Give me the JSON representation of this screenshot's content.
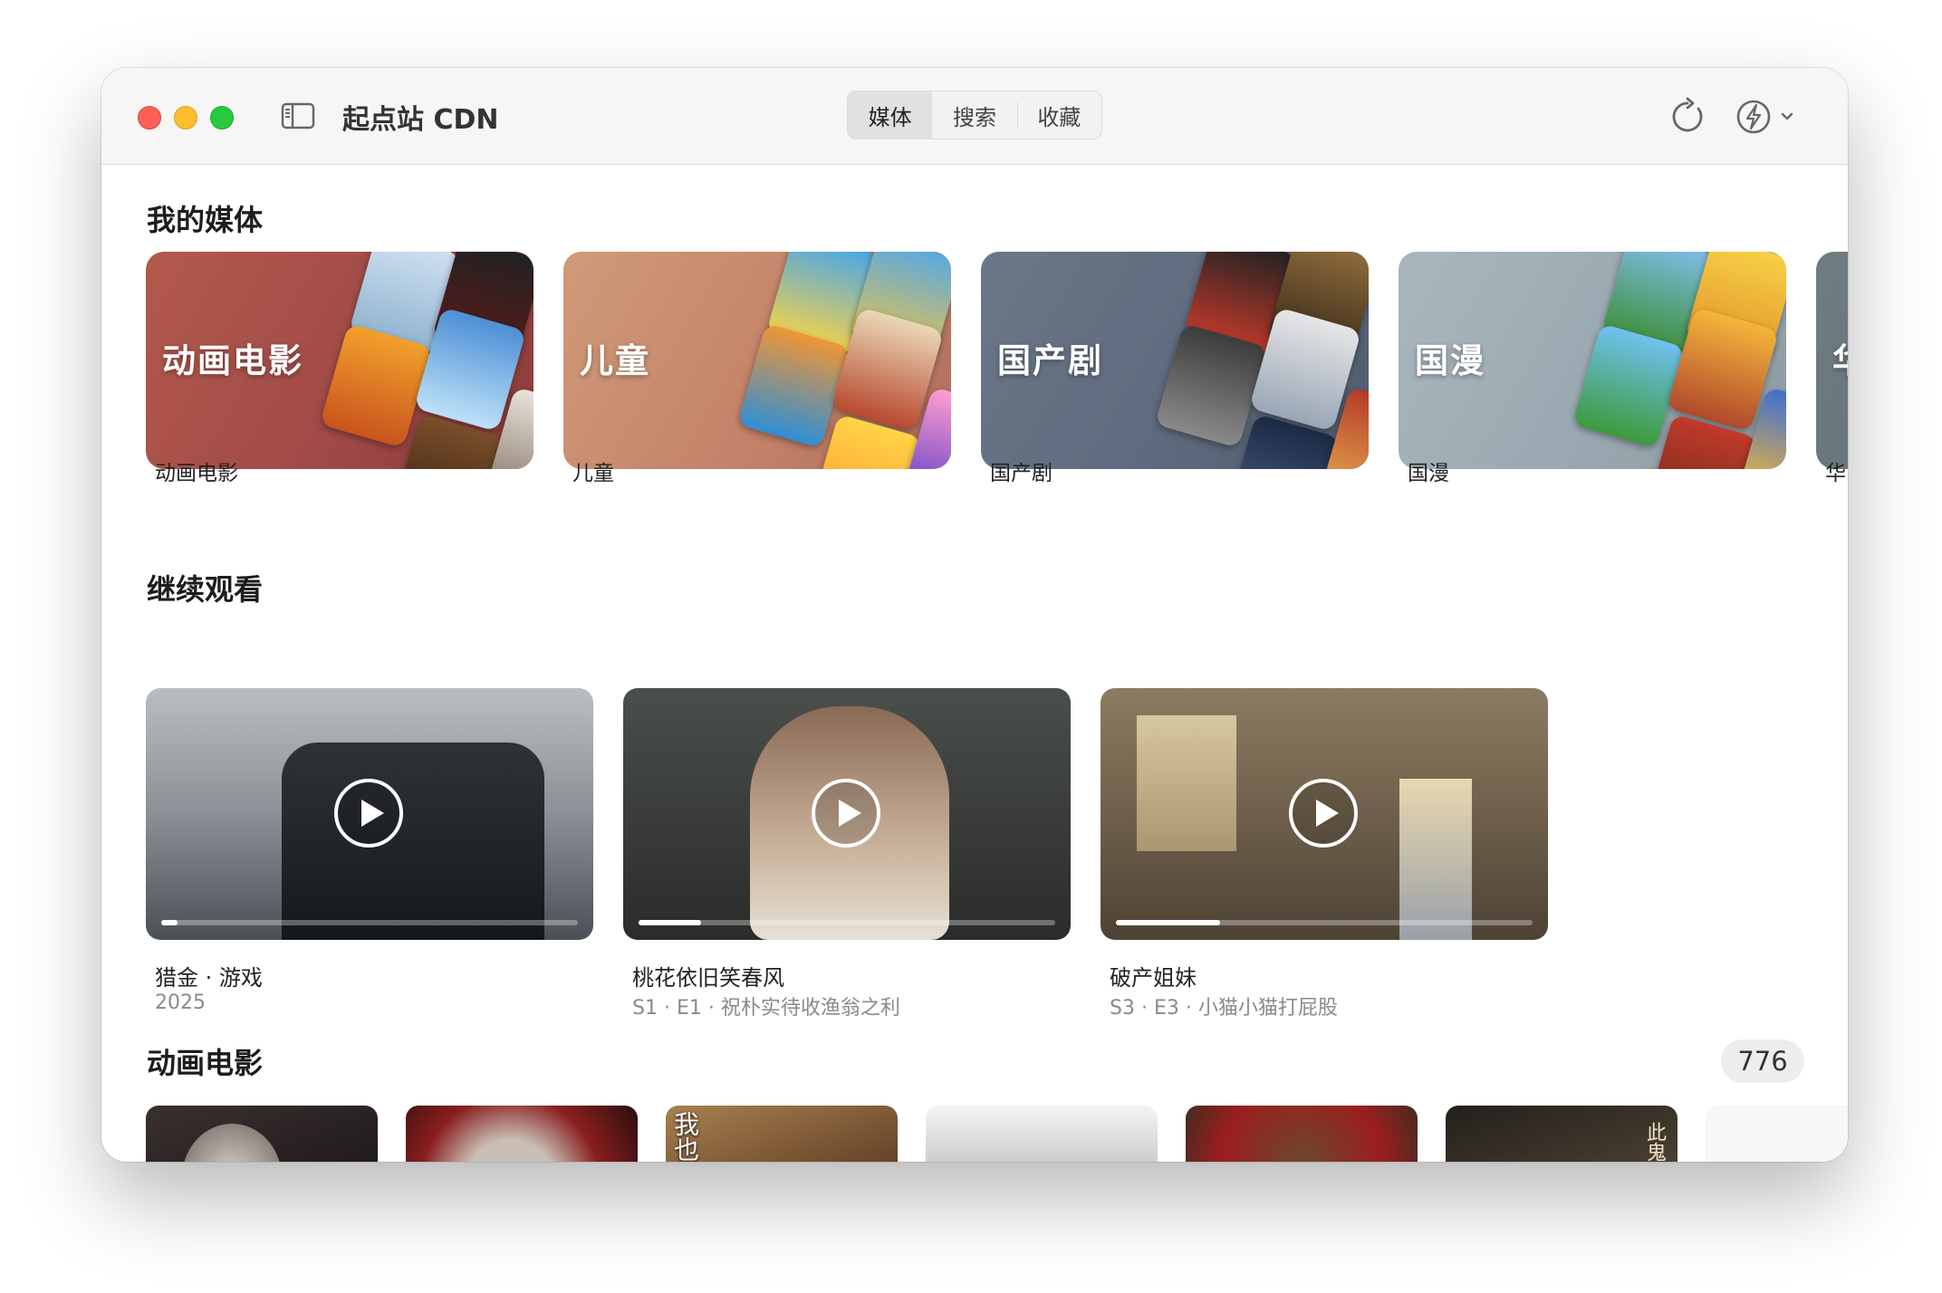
{
  "app": {
    "title": "起点站 CDN"
  },
  "tabs": [
    {
      "label": "媒体",
      "active": true
    },
    {
      "label": "搜索",
      "active": false
    },
    {
      "label": "收藏",
      "active": false
    }
  ],
  "toolbar": {
    "refresh_icon": "refresh-icon",
    "power_icon": "bolt-icon",
    "menu_icon": "chevron-down-icon"
  },
  "my_media": {
    "heading": "我的媒体",
    "items": [
      {
        "overlay": "动画电影",
        "label": "动画电影"
      },
      {
        "overlay": "儿童",
        "label": "儿童"
      },
      {
        "overlay": "国产剧",
        "label": "国产剧"
      },
      {
        "overlay": "国漫",
        "label": "国漫"
      },
      {
        "overlay": "华",
        "label": "华"
      }
    ]
  },
  "continue_watching": {
    "heading": "继续观看",
    "items": [
      {
        "title": "猎金 · 游戏",
        "subtitle": "2025",
        "progress": 0.04
      },
      {
        "title": "桃花依旧笑春风",
        "subtitle": "S1 · E1 · 祝朴实待收渔翁之利",
        "progress": 0.15
      },
      {
        "title": "破产姐妹",
        "subtitle": "S3 · E3 · 小猫小猫打屁股",
        "progress": 0.25
      }
    ]
  },
  "animated_movies": {
    "heading": "动画电影",
    "count": "776",
    "posters": [
      {
        "caption": ""
      },
      {
        "caption": ""
      },
      {
        "caption": "我也絕不灰"
      },
      {
        "caption": ""
      },
      {
        "caption": ""
      },
      {
        "caption": "此鬼名為"
      }
    ]
  },
  "colors": {
    "accent_close": "#fe5f57",
    "accent_min": "#febc2e",
    "accent_max": "#28c840",
    "badge_bg": "#ededef"
  }
}
